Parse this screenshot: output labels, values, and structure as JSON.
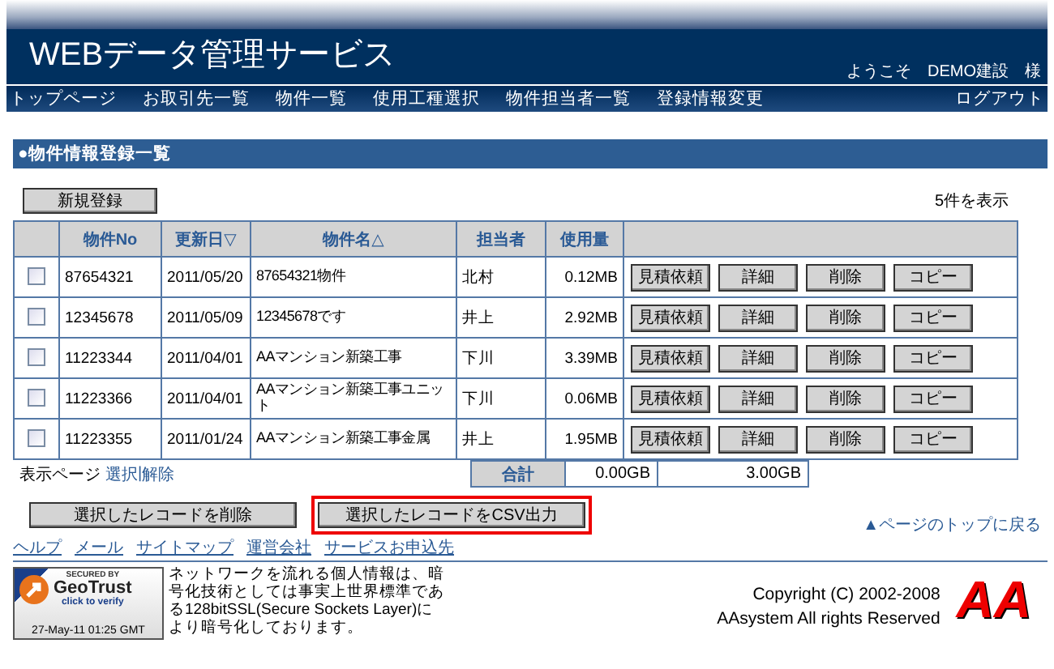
{
  "header": {
    "title": "WEBデータ管理サービス",
    "welcome": "ようこそ　DEMO建設　様"
  },
  "nav": {
    "items": [
      "トップページ",
      "お取引先一覧",
      "物件一覧",
      "使用工種選択",
      "物件担当者一覧",
      "登録情報変更"
    ],
    "logout": "ログアウト"
  },
  "section": {
    "title": "●物件情報登録一覧"
  },
  "new_button": "新規登録",
  "count": "5件を表示",
  "table": {
    "columns": [
      "物件No",
      "更新日▽",
      "物件名△",
      "担当者",
      "使用量"
    ],
    "rows": [
      {
        "checked": false,
        "no": "87654321",
        "date": "2011/05/20",
        "name": "87654321物件",
        "person": "北村",
        "usage": "0.12MB",
        "actions": [
          "見積依頼",
          "詳細",
          "削除",
          "コピー"
        ]
      },
      {
        "checked": false,
        "no": "12345678",
        "date": "2011/05/09",
        "name": "12345678です",
        "person": "井上",
        "usage": "2.92MB",
        "actions": [
          "見積依頼",
          "詳細",
          "削除",
          "コピー"
        ]
      },
      {
        "checked": false,
        "no": "11223344",
        "date": "2011/04/01",
        "name": "AAマンション新築工事",
        "person": "下川",
        "usage": "3.39MB",
        "actions": [
          "見積依頼",
          "詳細",
          "削除",
          "コピー"
        ]
      },
      {
        "checked": false,
        "no": "11223366",
        "date": "2011/04/01",
        "name": "AAマンション新築工事ユニット",
        "person": "下川",
        "usage": "0.06MB",
        "actions": [
          "見積依頼",
          "詳細",
          "削除",
          "コピー"
        ]
      },
      {
        "checked": false,
        "no": "11223355",
        "date": "2011/01/24",
        "name": "AAマンション新築工事金属",
        "person": "井上",
        "usage": "1.95MB",
        "actions": [
          "見積依頼",
          "詳細",
          "削除",
          "コピー"
        ]
      }
    ],
    "total_label": "合計",
    "total_used": "0.00GB",
    "total_capacity": "3.00GB"
  },
  "page_select": {
    "label": "表示ページ",
    "select": "選択",
    "separator": "|",
    "clear": "解除"
  },
  "bulk_buttons": [
    {
      "label": "選択したレコードを削除",
      "highlighted": false
    },
    {
      "label": "選択したレコードをCSV出力",
      "highlighted": true
    }
  ],
  "back_to_top": "▲ページのトップに戻る",
  "footer_links": [
    "ヘルプ",
    "メール",
    "サイトマップ",
    "運営会社",
    "サービスお申込先"
  ],
  "seal": {
    "secured_by": "SECURED BY",
    "brand": "GeoTrust",
    "verify": "click to verify",
    "timestamp": "27-May-11 01:25 GMT"
  },
  "ssl_note": "ネットワークを流れる個人情報は、暗号化技術としては事実上世界標準である128bitSSL(Secure Sockets Layer)により暗号化しております。",
  "copyright": [
    "Copyright (C) 2002-2008",
    "AAsystem All rights Reserved"
  ],
  "logo": "AA"
}
